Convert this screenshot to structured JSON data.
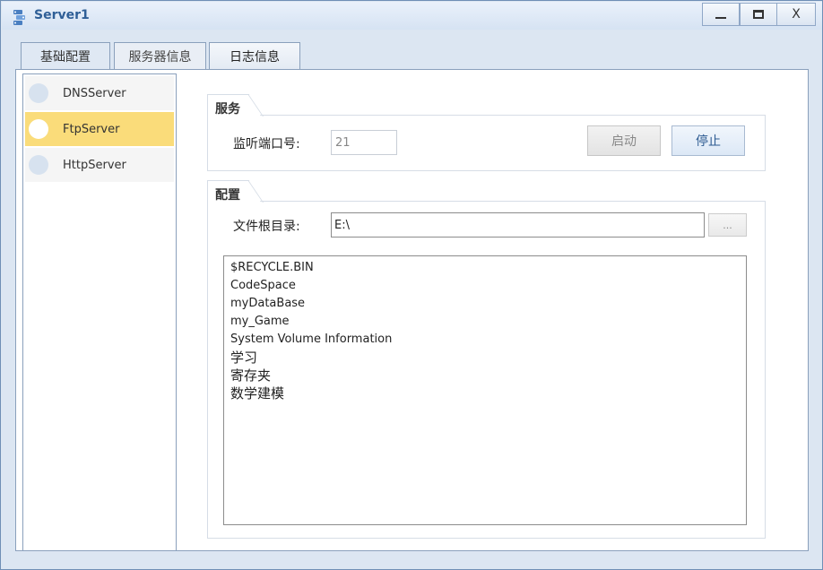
{
  "window": {
    "title": "Server1",
    "close_label": "X",
    "icon": "server-app-icon"
  },
  "tabs": [
    {
      "label": "基础配置"
    },
    {
      "label": "服务器信息"
    },
    {
      "label": "日志信息"
    }
  ],
  "servers": [
    {
      "label": "DNSServer",
      "selected": false
    },
    {
      "label": "FtpServer",
      "selected": true
    },
    {
      "label": "HttpServer",
      "selected": false
    }
  ],
  "service_group": {
    "title": "服务",
    "port_label": "监听端口号:",
    "port_value": "21",
    "start_label": "启动",
    "stop_label": "停止"
  },
  "config_group": {
    "title": "配置",
    "root_label": "文件根目录:",
    "root_value": "E:\\",
    "browse_label": "...",
    "files": [
      "$RECYCLE.BIN",
      "CodeSpace",
      "myDataBase",
      "my_Game",
      "System Volume Information",
      "学习",
      "寄存夹",
      "数学建模"
    ]
  },
  "colors": {
    "selected_item": "#fadc7a",
    "accent": "#2f5f97"
  }
}
